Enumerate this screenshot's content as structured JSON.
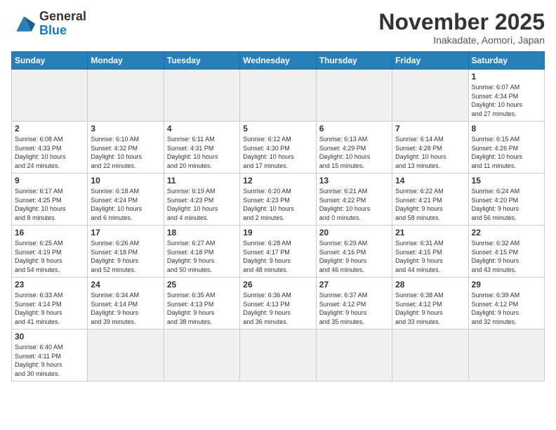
{
  "header": {
    "logo_general": "General",
    "logo_blue": "Blue",
    "month_title": "November 2025",
    "location": "Inakadate, Aomori, Japan"
  },
  "days_of_week": [
    "Sunday",
    "Monday",
    "Tuesday",
    "Wednesday",
    "Thursday",
    "Friday",
    "Saturday"
  ],
  "weeks": [
    [
      {
        "day": "",
        "info": "",
        "empty": true
      },
      {
        "day": "",
        "info": "",
        "empty": true
      },
      {
        "day": "",
        "info": "",
        "empty": true
      },
      {
        "day": "",
        "info": "",
        "empty": true
      },
      {
        "day": "",
        "info": "",
        "empty": true
      },
      {
        "day": "",
        "info": "",
        "empty": true
      },
      {
        "day": "1",
        "info": "Sunrise: 6:07 AM\nSunset: 4:34 PM\nDaylight: 10 hours\nand 27 minutes."
      }
    ],
    [
      {
        "day": "2",
        "info": "Sunrise: 6:08 AM\nSunset: 4:33 PM\nDaylight: 10 hours\nand 24 minutes."
      },
      {
        "day": "3",
        "info": "Sunrise: 6:10 AM\nSunset: 4:32 PM\nDaylight: 10 hours\nand 22 minutes."
      },
      {
        "day": "4",
        "info": "Sunrise: 6:11 AM\nSunset: 4:31 PM\nDaylight: 10 hours\nand 20 minutes."
      },
      {
        "day": "5",
        "info": "Sunrise: 6:12 AM\nSunset: 4:30 PM\nDaylight: 10 hours\nand 17 minutes."
      },
      {
        "day": "6",
        "info": "Sunrise: 6:13 AM\nSunset: 4:29 PM\nDaylight: 10 hours\nand 15 minutes."
      },
      {
        "day": "7",
        "info": "Sunrise: 6:14 AM\nSunset: 4:28 PM\nDaylight: 10 hours\nand 13 minutes."
      },
      {
        "day": "8",
        "info": "Sunrise: 6:15 AM\nSunset: 4:26 PM\nDaylight: 10 hours\nand 11 minutes."
      }
    ],
    [
      {
        "day": "9",
        "info": "Sunrise: 6:17 AM\nSunset: 4:25 PM\nDaylight: 10 hours\nand 8 minutes."
      },
      {
        "day": "10",
        "info": "Sunrise: 6:18 AM\nSunset: 4:24 PM\nDaylight: 10 hours\nand 6 minutes."
      },
      {
        "day": "11",
        "info": "Sunrise: 6:19 AM\nSunset: 4:23 PM\nDaylight: 10 hours\nand 4 minutes."
      },
      {
        "day": "12",
        "info": "Sunrise: 6:20 AM\nSunset: 4:23 PM\nDaylight: 10 hours\nand 2 minutes."
      },
      {
        "day": "13",
        "info": "Sunrise: 6:21 AM\nSunset: 4:22 PM\nDaylight: 10 hours\nand 0 minutes."
      },
      {
        "day": "14",
        "info": "Sunrise: 6:22 AM\nSunset: 4:21 PM\nDaylight: 9 hours\nand 58 minutes."
      },
      {
        "day": "15",
        "info": "Sunrise: 6:24 AM\nSunset: 4:20 PM\nDaylight: 9 hours\nand 56 minutes."
      }
    ],
    [
      {
        "day": "16",
        "info": "Sunrise: 6:25 AM\nSunset: 4:19 PM\nDaylight: 9 hours\nand 54 minutes."
      },
      {
        "day": "17",
        "info": "Sunrise: 6:26 AM\nSunset: 4:18 PM\nDaylight: 9 hours\nand 52 minutes."
      },
      {
        "day": "18",
        "info": "Sunrise: 6:27 AM\nSunset: 4:18 PM\nDaylight: 9 hours\nand 50 minutes."
      },
      {
        "day": "19",
        "info": "Sunrise: 6:28 AM\nSunset: 4:17 PM\nDaylight: 9 hours\nand 48 minutes."
      },
      {
        "day": "20",
        "info": "Sunrise: 6:29 AM\nSunset: 4:16 PM\nDaylight: 9 hours\nand 46 minutes."
      },
      {
        "day": "21",
        "info": "Sunrise: 6:31 AM\nSunset: 4:15 PM\nDaylight: 9 hours\nand 44 minutes."
      },
      {
        "day": "22",
        "info": "Sunrise: 6:32 AM\nSunset: 4:15 PM\nDaylight: 9 hours\nand 43 minutes."
      }
    ],
    [
      {
        "day": "23",
        "info": "Sunrise: 6:33 AM\nSunset: 4:14 PM\nDaylight: 9 hours\nand 41 minutes."
      },
      {
        "day": "24",
        "info": "Sunrise: 6:34 AM\nSunset: 4:14 PM\nDaylight: 9 hours\nand 39 minutes."
      },
      {
        "day": "25",
        "info": "Sunrise: 6:35 AM\nSunset: 4:13 PM\nDaylight: 9 hours\nand 38 minutes."
      },
      {
        "day": "26",
        "info": "Sunrise: 6:36 AM\nSunset: 4:13 PM\nDaylight: 9 hours\nand 36 minutes."
      },
      {
        "day": "27",
        "info": "Sunrise: 6:37 AM\nSunset: 4:12 PM\nDaylight: 9 hours\nand 35 minutes."
      },
      {
        "day": "28",
        "info": "Sunrise: 6:38 AM\nSunset: 4:12 PM\nDaylight: 9 hours\nand 33 minutes."
      },
      {
        "day": "29",
        "info": "Sunrise: 6:39 AM\nSunset: 4:12 PM\nDaylight: 9 hours\nand 32 minutes."
      }
    ],
    [
      {
        "day": "30",
        "info": "Sunrise: 6:40 AM\nSunset: 4:11 PM\nDaylight: 9 hours\nand 30 minutes."
      },
      {
        "day": "",
        "info": "",
        "empty": true
      },
      {
        "day": "",
        "info": "",
        "empty": true
      },
      {
        "day": "",
        "info": "",
        "empty": true
      },
      {
        "day": "",
        "info": "",
        "empty": true
      },
      {
        "day": "",
        "info": "",
        "empty": true
      },
      {
        "day": "",
        "info": "",
        "empty": true
      }
    ]
  ]
}
